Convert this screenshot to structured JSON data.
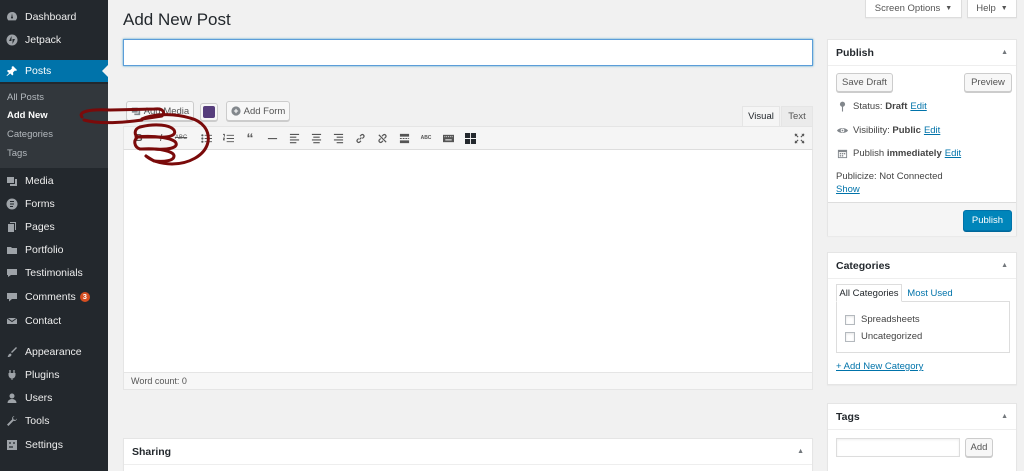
{
  "sidebar": {
    "dashboard": "Dashboard",
    "jetpack": "Jetpack",
    "posts": "Posts",
    "submenu": [
      "All Posts",
      "Add New",
      "Categories",
      "Tags"
    ],
    "media": "Media",
    "forms": "Forms",
    "pages": "Pages",
    "portfolio": "Portfolio",
    "testimonials": "Testimonials",
    "comments": "Comments",
    "comments_count": "3",
    "contact": "Contact",
    "appearance": "Appearance",
    "plugins": "Plugins",
    "users": "Users",
    "tools": "Tools",
    "settings": "Settings"
  },
  "header": {
    "title": "Add New Post",
    "screen_options": "Screen Options",
    "help": "Help"
  },
  "editor": {
    "title_value": "",
    "add_media": "Add Media",
    "add_form": "Add Form",
    "tabs": [
      "Visual",
      "Text"
    ],
    "active_tab": "Visual",
    "toolbar_bold": "B",
    "toolbar_italic": "I",
    "toolbar_strike": "ABC",
    "toolbar_quote": "“",
    "toolbar_spell": "ABC",
    "word_count": "Word count: 0"
  },
  "sharing": {
    "title": "Sharing"
  },
  "publish": {
    "title": "Publish",
    "save_draft": "Save Draft",
    "preview": "Preview",
    "status_label": "Status:",
    "status_value": "Draft",
    "visibility_label": "Visibility:",
    "visibility_value": "Public",
    "schedule_label": "Publish",
    "schedule_value": "immediately",
    "edit": "Edit",
    "publicize": "Publicize: Not Connected",
    "show": "Show",
    "publish_button": "Publish"
  },
  "categories": {
    "title": "Categories",
    "tabs": [
      "All Categories",
      "Most Used"
    ],
    "items": [
      "Spreadsheets",
      "Uncategorized"
    ],
    "add_new": "+ Add New Category"
  },
  "tags": {
    "title": "Tags",
    "add_button": "Add",
    "input_value": ""
  },
  "colors": {
    "sidebar_bg": "#23282d",
    "accent": "#0073aa",
    "primary_button": "#0085ba",
    "annotation": "#7a0a0a"
  }
}
